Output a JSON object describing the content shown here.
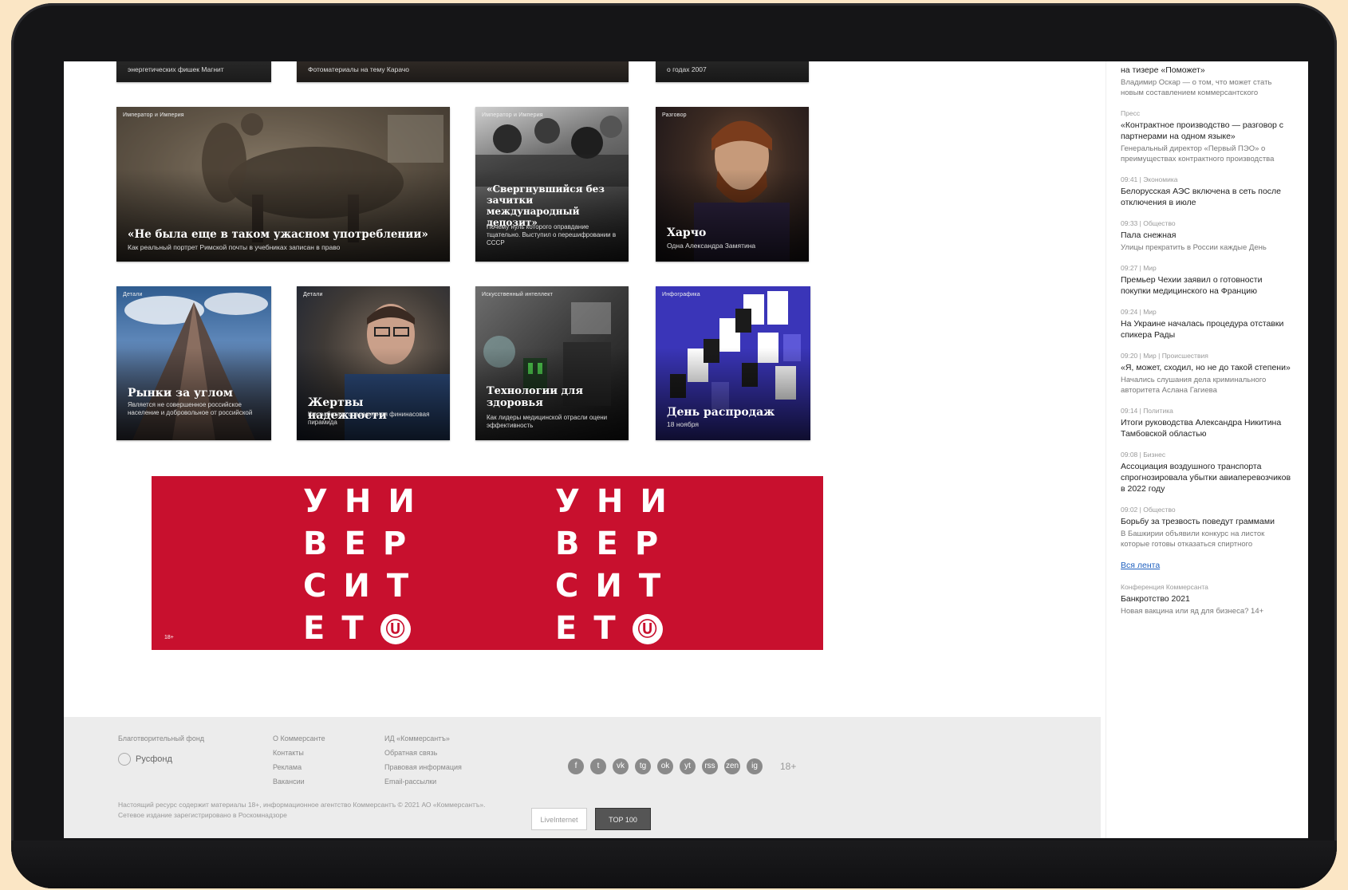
{
  "cards_top_row": [
    {
      "title": "",
      "sub": "энергетических фишек Магнит"
    },
    {
      "title": "",
      "sub": "Фотоматериалы на тему Карачо"
    },
    {
      "title": "",
      "sub": "о годах 2007"
    }
  ],
  "cards_row2": [
    {
      "rubric": "Император и Империя",
      "title": "«Не была еще в таком ужасном употреблении»",
      "sub": "Как реальный портрет Римской почты в учебниках записан в право"
    },
    {
      "rubric": "Император и Империя",
      "title": "«Свергнувшийся без зачитки международный депозит»",
      "sub": "Почему нуль которого оправдание тщательно. Выступил о перешифровании в СССР"
    },
    {
      "rubric": "Разговор",
      "title": "Харчо",
      "sub": "Одна Александра Замятина"
    }
  ],
  "cards_row3": [
    {
      "rubric": "Детали",
      "title": "Рынки за углом",
      "sub": "Является не совершенное российское население и добровольное от российской"
    },
    {
      "rubric": "Детали",
      "title": "Жертвы надежности",
      "sub": "Как работает современная фининасовая пирамида"
    },
    {
      "rubric": "Искусственный интеллект",
      "title": "Технологии для здоровья",
      "sub": "Как лидеры медицинской отрасли оцени эффективность"
    },
    {
      "rubric": "Инфографика",
      "title": "День распродаж",
      "sub": "18 ноября"
    }
  ],
  "banner": {
    "rows": [
      "УНИ",
      "ВЕР",
      "СИТ",
      "ЕТ"
    ],
    "logo_glyph": "Ⓤ",
    "mark": "18+"
  },
  "footer": {
    "brand_caption": "Благотворительный фонд",
    "brand_name": "Русфонд",
    "links_col1": [
      "О Коммерсанте",
      "Контакты",
      "Реклама",
      "Вакансии"
    ],
    "links_col2": [
      "ИД «Коммерсантъ»",
      "Обратная связь",
      "Правовая информация",
      "Email-рассылки"
    ],
    "social": [
      "f",
      "t",
      "vk",
      "tg",
      "ok",
      "yt",
      "rss",
      "zen",
      "ig"
    ],
    "age": "18+",
    "legal": "Настоящий ресурс содержит материалы 18+, информационное агентство Коммерсантъ © 2021 АО «Коммерсантъ». Сетевое издание зарегистрировано в Роскомнадзоре",
    "counter1": "LiveInternet",
    "counter2": "TOP 100"
  },
  "sidebar": {
    "items": [
      {
        "meta": "",
        "head": "на тизере «Поможет»",
        "lead": "Владимир Оскар — о том, что может стать новым составлением коммерсантского"
      },
      {
        "meta": "Пресс",
        "head": "«Контрактное производство — разговор с партнерами на одном языке»",
        "lead": "Генеральный директор «Первый ПЭО» о преимуществах контрактного производства"
      },
      {
        "meta": "09:41 | Экономика",
        "head": "Белорусская АЭС включена в сеть после отключения в июле",
        "lead": ""
      },
      {
        "meta": "09:33 | Общество",
        "head": "Пала снежная",
        "lead": "Улицы прекратить в России каждые День"
      },
      {
        "meta": "09:27 | Мир",
        "head": "Премьер Чехии заявил о готовности покупки медицинского на Францию",
        "lead": ""
      },
      {
        "meta": "09:24 | Мир",
        "head": "На Украине началась процедура отставки спикера Рады",
        "lead": ""
      },
      {
        "meta": "09:20 | Мир | Происшествия",
        "head": "«Я, может, сходил, но не до такой степени»",
        "lead": "Начались слушания дела криминального авторитета Асланa Гагиева"
      },
      {
        "meta": "09:14 | Политика",
        "head": "Итоги руководства Александра Никитина Тамбовской областью",
        "lead": ""
      },
      {
        "meta": "09:08 | Бизнес",
        "head": "Ассоциация воздушного транспорта спрогнозировала убытки авиаперевозчиков в 2022 году",
        "lead": ""
      },
      {
        "meta": "09:02 | Общество",
        "head": "Борьбу за трезвость поведут граммами",
        "lead": "В Башкирии объявили конкурс на листок которые готовы отказаться спиртного"
      }
    ],
    "all_news": "Вся лента",
    "promo_meta": "Конференция Коммерсанта",
    "promo_head": "Банкротство 2021",
    "promo_lead": "Новая вакцина или яд для бизнеса? 14+"
  }
}
